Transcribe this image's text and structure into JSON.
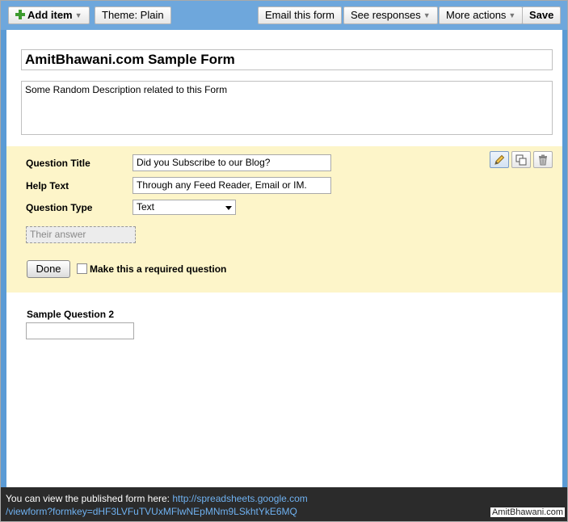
{
  "toolbar": {
    "add_item": "Add item",
    "theme": "Theme:  Plain",
    "email_form": "Email this form",
    "see_responses": "See responses",
    "more_actions": "More actions",
    "save": "Save"
  },
  "form": {
    "title": "AmitBhawani.com Sample Form",
    "description": "Some Random Description related to this Form"
  },
  "question_editor": {
    "title_label": "Question Title",
    "title_value": "Did you Subscribe to our Blog?",
    "help_label": "Help Text",
    "help_value": "Through any Feed Reader, Email or IM.",
    "type_label": "Question Type",
    "type_value": "Text",
    "answer_placeholder": "Their answer",
    "done_label": "Done",
    "required_label": "Make this a required question",
    "required_checked": false,
    "icons": [
      "pencil-icon",
      "duplicate-icon",
      "trash-icon"
    ]
  },
  "question2": {
    "label": "Sample Question 2"
  },
  "footer": {
    "prefix": "You can view the published form here: ",
    "url_line1": "http://spreadsheets.google.com",
    "url_line2": "/viewform?formkey=dHF3LVFuTVUxMFlwNEpMNm9LSkhtYkE6MQ",
    "watermark": "AmitBhawani.com"
  },
  "colors": {
    "toolbar": "#6ea7dc",
    "question_panel": "#fdf5c9",
    "footer": "#2b2b2b",
    "link": "#6fb1f0",
    "add_icon": "#3c9a2f"
  }
}
